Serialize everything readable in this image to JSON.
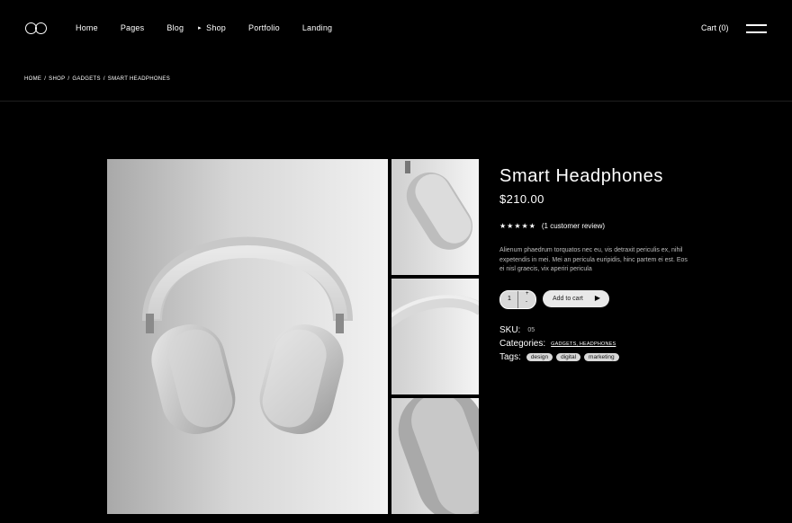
{
  "header": {
    "nav": [
      "Home",
      "Pages",
      "Blog",
      "Shop",
      "Portfolio",
      "Landing"
    ],
    "active_caret": "▸",
    "cart": "Cart (0)"
  },
  "breadcrumb": [
    "HOME",
    "SHOP",
    "GADGETS",
    "SMART HEADPHONES"
  ],
  "product": {
    "title": "Smart Headphones",
    "price": "$210.00",
    "stars": "★★★★★",
    "review": "(1 customer review)",
    "description": "Alienum phaedrum torquatos nec eu, vis detraxit periculis ex, nihil expetendis in mei. Mei an pericula euripidis, hinc partem ei est. Eos ei nisl graecis, vix aperiri pericula",
    "quantity": "1",
    "add_to_cart": "Add to cart",
    "sku_label": "SKU:",
    "sku": "05",
    "categories_label": "Categories:",
    "categories": "GADGETS, HEADPHONES",
    "tags_label": "Tags:",
    "tags": [
      "design",
      "digital",
      "marketing"
    ]
  }
}
